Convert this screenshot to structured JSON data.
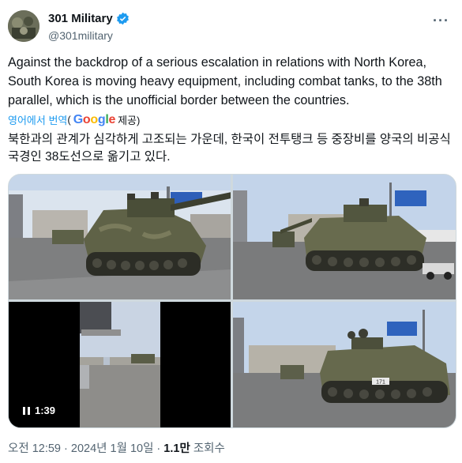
{
  "author": {
    "name": "301 Military",
    "handle": "@301military"
  },
  "tweet": {
    "text": "Against the backdrop of a serious escalation in relations with North Korea, South Korea is moving heavy equipment, including combat tanks, to the 38th parallel, which is the unofficial border between the countries.",
    "translate_label": "영어에서 번역",
    "translate_open": "(",
    "translate_provider": "Google",
    "translate_by": "제공)",
    "translated_text": "북한과의 관계가 심각하게 고조되는 가운데, 한국이 전투탱크 등 중장비를 양국의 비공식 국경인 38도선으로 옮기고 있다."
  },
  "media": {
    "video_duration": "1:39",
    "tank_number": "171"
  },
  "meta": {
    "time": "오전 12:59 · 2024년 1월 10일 ·",
    "views_count": "1.1만",
    "views_label": "조회수"
  },
  "icons": [
    "verified-badge-icon",
    "more-options-icon",
    "pause-icon"
  ],
  "colors": {
    "accent": "#1d9bf0",
    "secondary_text": "#536471"
  }
}
